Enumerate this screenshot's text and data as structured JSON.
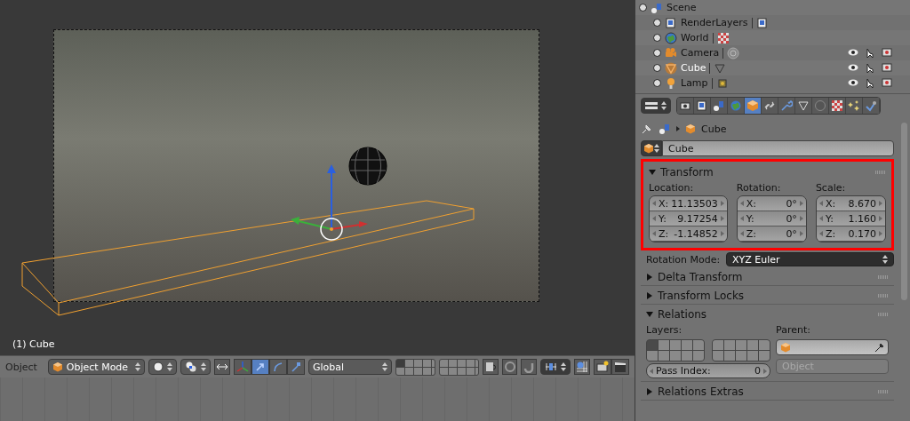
{
  "viewport": {
    "object_label": "(1) Cube"
  },
  "header": {
    "menu": "Object",
    "mode": "Object Mode",
    "orientation": "Global",
    "manipulators": [
      {
        "kind": "translate",
        "selected": true
      },
      {
        "kind": "rotate",
        "selected": false
      },
      {
        "kind": "scale",
        "selected": false
      }
    ],
    "layers": [
      {
        "selected": true
      },
      {
        "selected": false
      },
      {
        "selected": false
      },
      {
        "selected": false
      },
      {
        "selected": false
      },
      {
        "selected": false
      },
      {
        "selected": false
      },
      {
        "selected": false
      },
      {
        "selected": false
      },
      {
        "selected": false
      },
      {
        "selected": false
      },
      {
        "selected": false
      },
      {
        "selected": false
      },
      {
        "selected": false
      },
      {
        "selected": false
      },
      {
        "selected": false
      },
      {
        "selected": false
      },
      {
        "selected": false
      },
      {
        "selected": false
      },
      {
        "selected": false
      }
    ]
  },
  "outliner": {
    "scene": {
      "name": "Scene",
      "expanded": true
    },
    "items": [
      {
        "kind": "renderlayers",
        "name": "RenderLayers",
        "selected": false,
        "restrict_icons": false
      },
      {
        "kind": "world",
        "name": "World",
        "selected": false,
        "restrict_icons": false
      },
      {
        "kind": "camera",
        "name": "Camera",
        "selected": false,
        "restrict_icons": true
      },
      {
        "kind": "mesh",
        "name": "Cube",
        "selected": true,
        "restrict_icons": true
      },
      {
        "kind": "lamp",
        "name": "Lamp",
        "selected": false,
        "restrict_icons": true
      }
    ]
  },
  "properties": {
    "tabs": [
      {
        "kind": "render",
        "selected": false
      },
      {
        "kind": "layers",
        "selected": false
      },
      {
        "kind": "scene",
        "selected": false
      },
      {
        "kind": "world",
        "selected": false
      },
      {
        "kind": "object",
        "selected": true
      },
      {
        "kind": "constraints",
        "selected": false
      },
      {
        "kind": "modifiers",
        "selected": false
      },
      {
        "kind": "data",
        "selected": false
      },
      {
        "kind": "material",
        "selected": false
      },
      {
        "kind": "texture",
        "selected": false
      },
      {
        "kind": "particles",
        "selected": false
      },
      {
        "kind": "physics",
        "selected": false
      }
    ],
    "breadcrumb": "Cube",
    "object_name": "Cube",
    "transform": {
      "title": "Transform",
      "expanded": true,
      "highlighted": true,
      "groups": [
        {
          "label": "Location:",
          "fields": [
            {
              "axis": "X:",
              "value": "11.13503"
            },
            {
              "axis": "Y:",
              "value": "9.17254"
            },
            {
              "axis": "Z:",
              "value": "-1.14852"
            }
          ]
        },
        {
          "label": "Rotation:",
          "fields": [
            {
              "axis": "X:",
              "value": "0°"
            },
            {
              "axis": "Y:",
              "value": "0°"
            },
            {
              "axis": "Z:",
              "value": "0°"
            }
          ]
        },
        {
          "label": "Scale:",
          "fields": [
            {
              "axis": "X:",
              "value": "8.670"
            },
            {
              "axis": "Y:",
              "value": "1.160"
            },
            {
              "axis": "Z:",
              "value": "0.170"
            }
          ]
        }
      ],
      "rotation_mode_label": "Rotation Mode:",
      "rotation_mode": "XYZ Euler"
    },
    "collapsed_panels": [
      {
        "title": "Delta Transform",
        "expanded": false
      },
      {
        "title": "Transform Locks",
        "expanded": false
      }
    ],
    "relations": {
      "title": "Relations",
      "expanded": true,
      "layers_label": "Layers:",
      "parent_label": "Parent:",
      "parent_type": "Object",
      "pass_index_label": "Pass Index:",
      "pass_index": "0",
      "layers": [
        {
          "selected": true
        },
        {
          "selected": false
        },
        {
          "selected": false
        },
        {
          "selected": false
        },
        {
          "selected": false
        },
        {
          "selected": false
        },
        {
          "selected": false
        },
        {
          "selected": false
        },
        {
          "selected": false
        },
        {
          "selected": false
        },
        {
          "selected": false
        },
        {
          "selected": false
        },
        {
          "selected": false
        },
        {
          "selected": false
        },
        {
          "selected": false
        },
        {
          "selected": false
        },
        {
          "selected": false
        },
        {
          "selected": false
        },
        {
          "selected": false
        },
        {
          "selected": false
        }
      ]
    },
    "last_panel": {
      "title": "Relations Extras",
      "expanded": false
    }
  }
}
